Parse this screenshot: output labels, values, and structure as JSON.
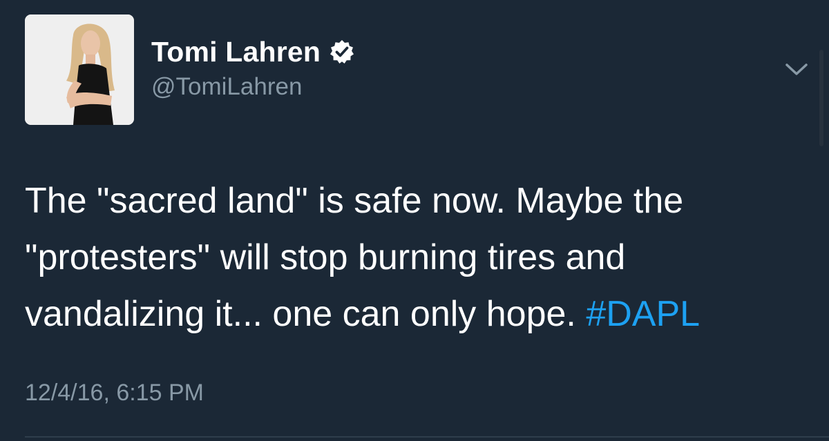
{
  "user": {
    "display_name": "Tomi Lahren",
    "handle": "@TomiLahren",
    "verified": true
  },
  "tweet": {
    "text_lines": [
      "The \"sacred land\" is safe now. Maybe the",
      "\"protesters\" will stop burning tires and",
      "vandalizing it... one can only hope. "
    ],
    "hashtag": "#DAPL",
    "timestamp": "12/4/16, 6:15 PM"
  },
  "icons": {
    "verified": "verified-badge-icon",
    "menu": "chevron-down-icon"
  },
  "colors": {
    "background": "#1b2836",
    "text": "#ffffff",
    "secondary": "#8899a6",
    "link": "#1da1f2"
  }
}
